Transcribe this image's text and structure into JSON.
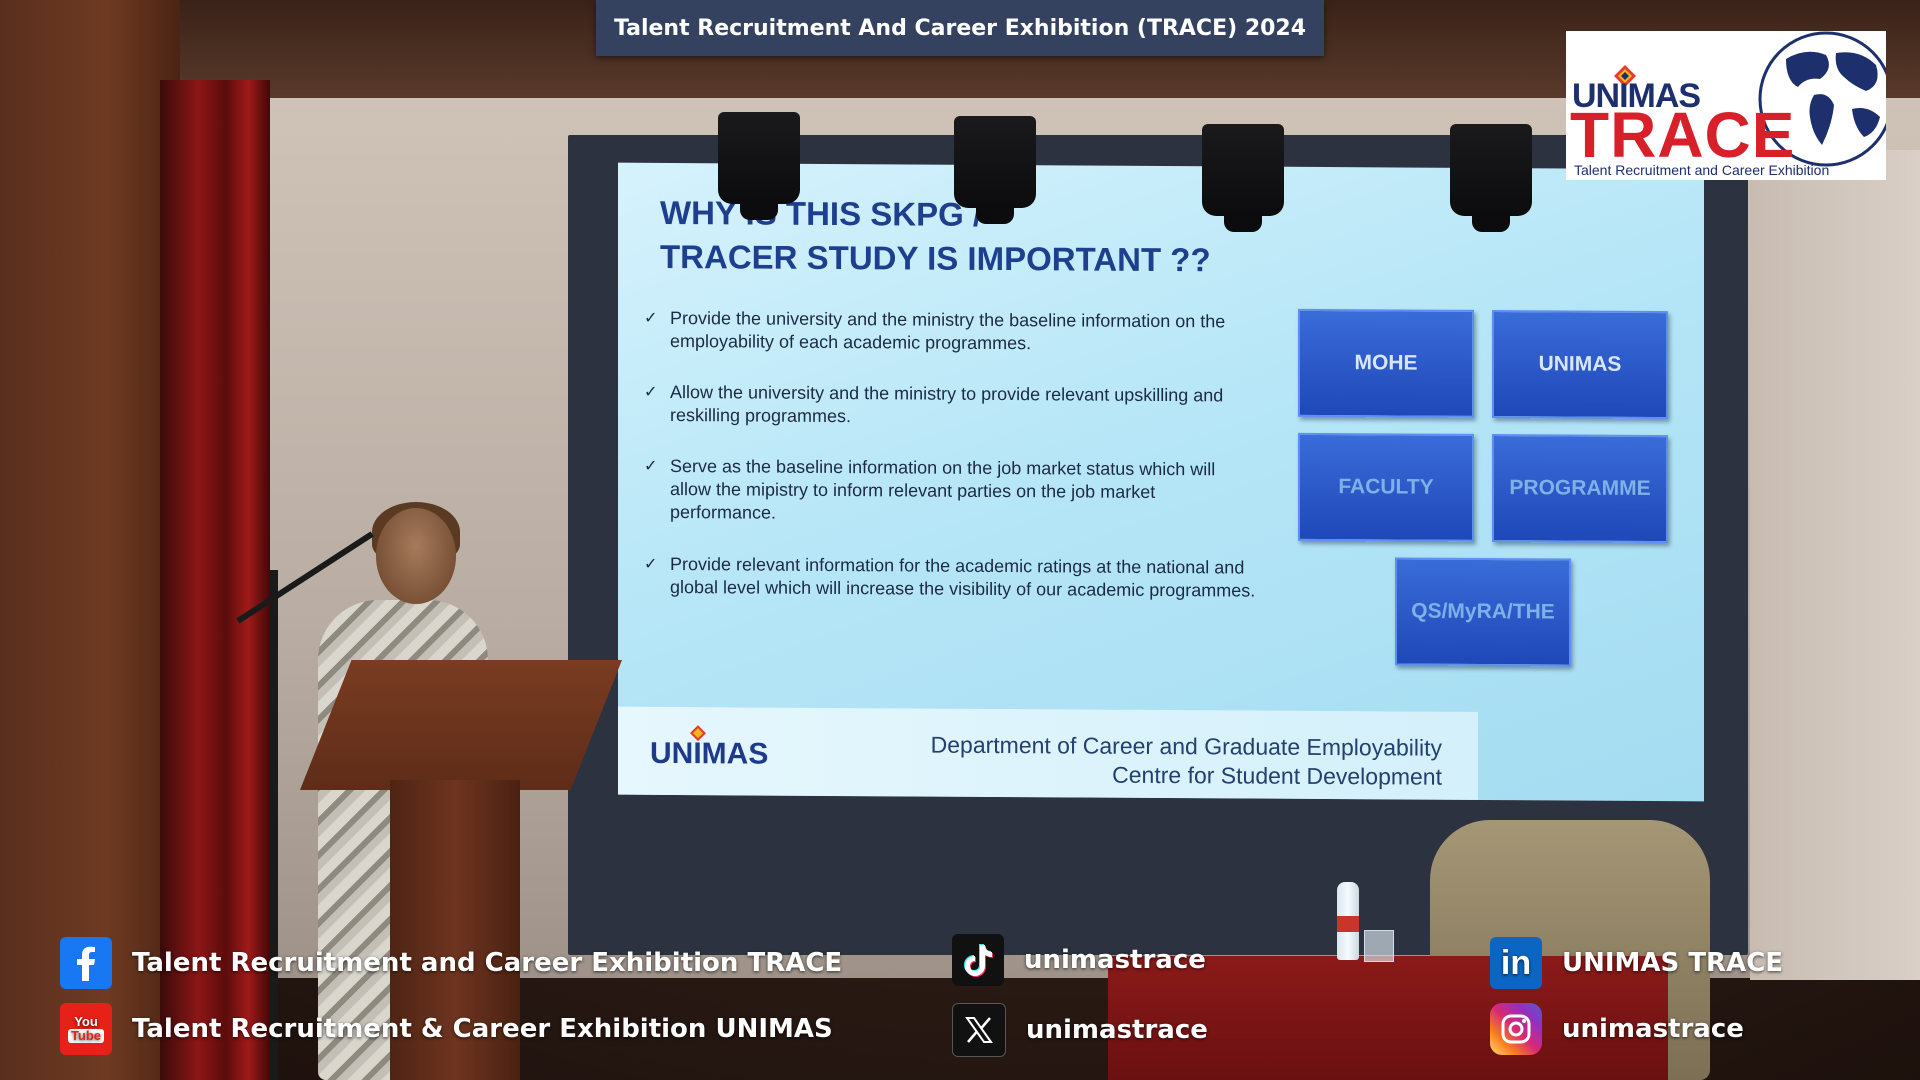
{
  "banner": {
    "title": "Talent Recruitment And Career Exhibition (TRACE) 2024"
  },
  "logo": {
    "brand": "UNIMAS",
    "name": "TRACE",
    "tagline": "Talent Recruitment and Career Exhibition",
    "colors": {
      "navy": "#1e2f6e",
      "red": "#d8202a"
    }
  },
  "slide": {
    "title": "WHY IS THIS SKPG /\nTRACER STUDY IS IMPORTANT ??",
    "bullets": [
      "Provide the university and the ministry the baseline information on the employability of each academic programmes.",
      "Allow the university and the ministry to provide relevant upskilling and reskilling programmes.",
      "Serve as the baseline information on the job market status which will allow the mipistry to inform relevant parties on the job market performance.",
      "Provide relevant information for the academic ratings at the national and global level which will increase the visibility of our academic programmes."
    ],
    "bullet_marker": "✓",
    "boxes": [
      "MOHE",
      "UNIMAS",
      "FACULTY",
      "PROGRAMME",
      "QS/MyRA/THE"
    ],
    "footer": {
      "logo_text": "UNIMAS",
      "department_line1": "Department of Career and Graduate Employability",
      "department_line2": "Centre for Student Development"
    }
  },
  "social": {
    "facebook": {
      "icon": "facebook-icon",
      "label": "Talent Recruitment and Career Exhibition TRACE",
      "color": "#1877f2"
    },
    "youtube": {
      "icon": "youtube-icon",
      "label": "Talent Recruitment & Career Exhibition UNIMAS",
      "color": "#e62117"
    },
    "tiktok": {
      "icon": "tiktok-icon",
      "label": "unimastrace",
      "color": "#000000"
    },
    "x": {
      "icon": "x-icon",
      "label": "unimastrace",
      "color": "#000000"
    },
    "linkedin": {
      "icon": "linkedin-icon",
      "label": "UNIMAS TRACE",
      "color": "#0a66c2"
    },
    "instagram": {
      "icon": "instagram-icon",
      "label": "unimastrace",
      "color": "#d6249f"
    }
  }
}
